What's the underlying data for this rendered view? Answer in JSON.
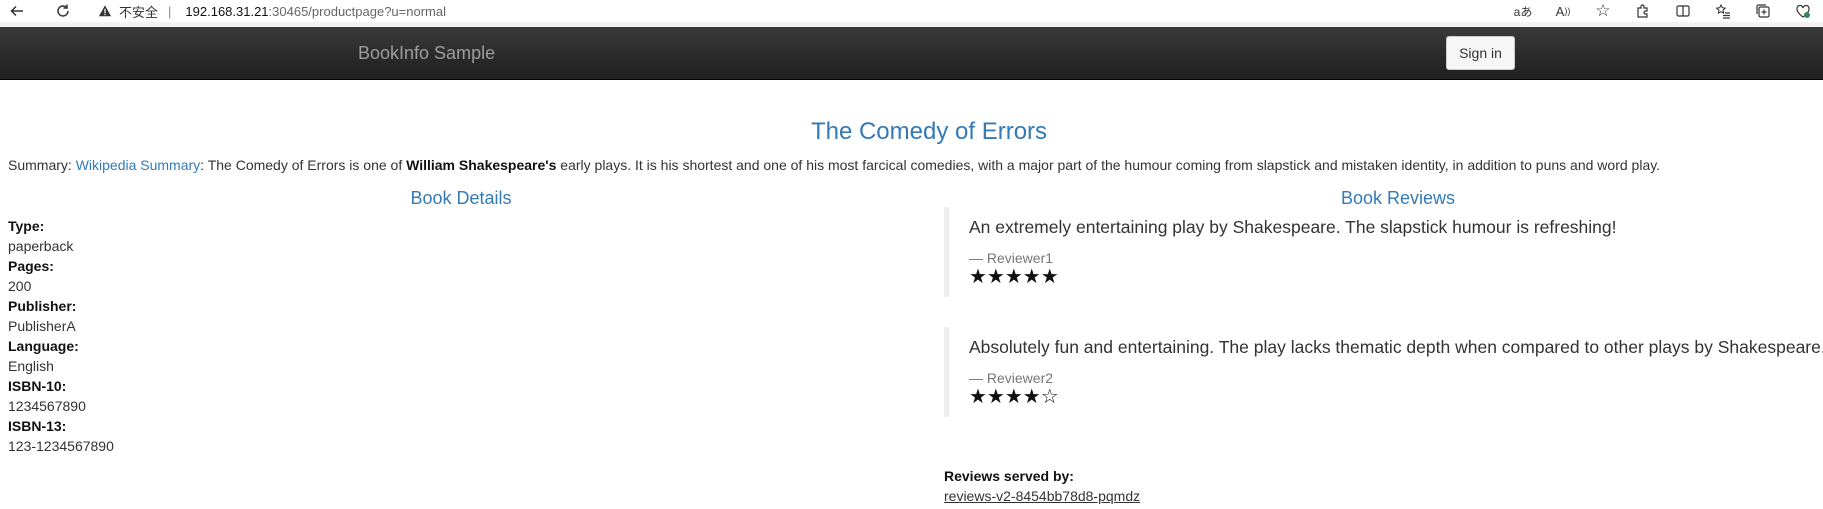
{
  "browser": {
    "insecure_label": "不安全",
    "url_host": "192.168.31.21",
    "url_rest": ":30465/productpage?u=normal",
    "separator": "|"
  },
  "navbar": {
    "brand": "BookInfo Sample",
    "signin_label": "Sign in"
  },
  "book": {
    "title": "The Comedy of Errors",
    "summary_prefix": "Summary: ",
    "summary_link": "Wikipedia Summary",
    "summary_text1": ": The Comedy of Errors is one of ",
    "summary_bold": "William Shakespeare's",
    "summary_text2": " early plays. It is his shortest and one of his most farcical comedies, with a major part of the humour coming from slapstick and mistaken identity, in addition to puns and word play."
  },
  "details": {
    "heading": "Book Details",
    "type_label": "Type:",
    "type_value": "paperback",
    "pages_label": "Pages:",
    "pages_value": "200",
    "publisher_label": "Publisher:",
    "publisher_value": "PublisherA",
    "language_label": "Language:",
    "language_value": "English",
    "isbn10_label": "ISBN-10:",
    "isbn10_value": "1234567890",
    "isbn13_label": "ISBN-13:",
    "isbn13_value": "123-1234567890"
  },
  "reviews": {
    "heading": "Book Reviews",
    "items": [
      {
        "text": "An extremely entertaining play by Shakespeare. The slapstick humour is refreshing!",
        "reviewer": "— Reviewer1",
        "stars": "★★★★★",
        "rating": 5
      },
      {
        "text": "Absolutely fun and entertaining. The play lacks thematic depth when compared to other plays by Shakespeare.",
        "reviewer": "— Reviewer2",
        "stars": "★★★★☆",
        "rating": 4
      }
    ],
    "served_label": "Reviews served by:",
    "served_by": "reviews-v2-8454bb78d8-pqmdz"
  },
  "icons": {
    "back": "back-arrow-icon",
    "reload": "reload-icon",
    "warning": "warning-icon",
    "read_aloud": "read-aloud-icon",
    "translate": "translate-icon",
    "favorite": "star-outline-icon",
    "extensions": "puzzle-icon",
    "split": "split-screen-icon",
    "favorites_list": "favorites-list-icon",
    "collections": "collections-icon",
    "health": "heart-health-icon"
  }
}
